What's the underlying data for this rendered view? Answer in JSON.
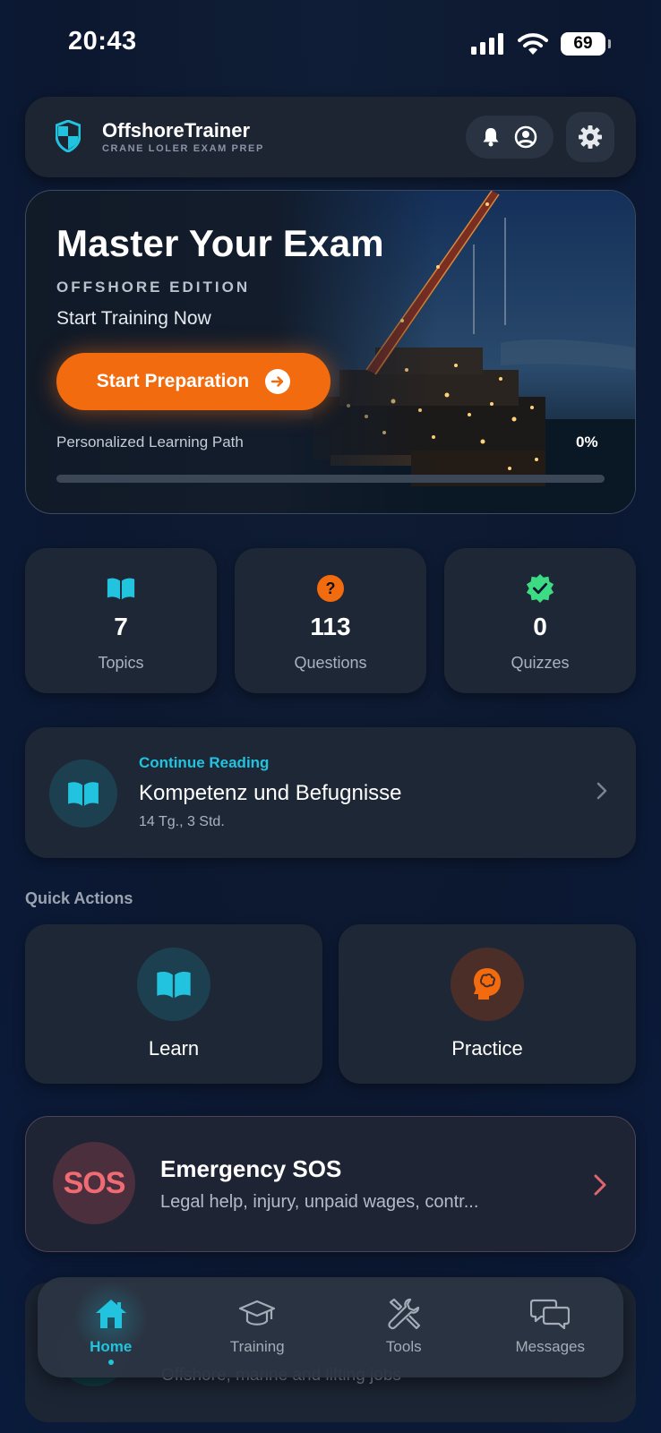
{
  "status_bar": {
    "time": "20:43",
    "battery": "69"
  },
  "header": {
    "app_name": "OffshoreTrainer",
    "app_subtitle": "CRANE LOLER EXAM PREP"
  },
  "hero": {
    "title": "Master Your Exam",
    "edition": "OFFSHORE EDITION",
    "subtitle": "Start Training Now",
    "button_label": "Start Preparation",
    "path_label": "Personalized Learning Path",
    "path_percent": "0%",
    "progress": 0
  },
  "stats": [
    {
      "value": "7",
      "label": "Topics",
      "icon": "book-icon"
    },
    {
      "value": "113",
      "label": "Questions",
      "icon": "question-icon"
    },
    {
      "value": "0",
      "label": "Quizzes",
      "icon": "verified-badge-icon"
    }
  ],
  "continue_reading": {
    "kicker": "Continue Reading",
    "title": "Kompetenz und Befugnisse",
    "meta": "14 Tg., 3 Std."
  },
  "quick_actions": {
    "title": "Quick Actions",
    "items": [
      {
        "label": "Learn",
        "icon": "book-icon"
      },
      {
        "label": "Practice",
        "icon": "brain-head-icon"
      }
    ]
  },
  "sos": {
    "badge": "SOS",
    "title": "Emergency SOS",
    "subtitle": "Legal help, injury, unpaid wages, contr..."
  },
  "partial_card": {
    "text": "Offshore, marine and lifting jobs"
  },
  "tabbar": {
    "tabs": [
      {
        "label": "Home",
        "icon": "home-icon",
        "active": true
      },
      {
        "label": "Training",
        "icon": "graduation-cap-icon",
        "active": false
      },
      {
        "label": "Tools",
        "icon": "tools-icon",
        "active": false
      },
      {
        "label": "Messages",
        "icon": "messages-icon",
        "active": false
      }
    ]
  },
  "colors": {
    "accent_cyan": "#22c3de",
    "accent_orange": "#f26b0f",
    "sos_red": "#f06b73",
    "success_green": "#3ddc84"
  }
}
